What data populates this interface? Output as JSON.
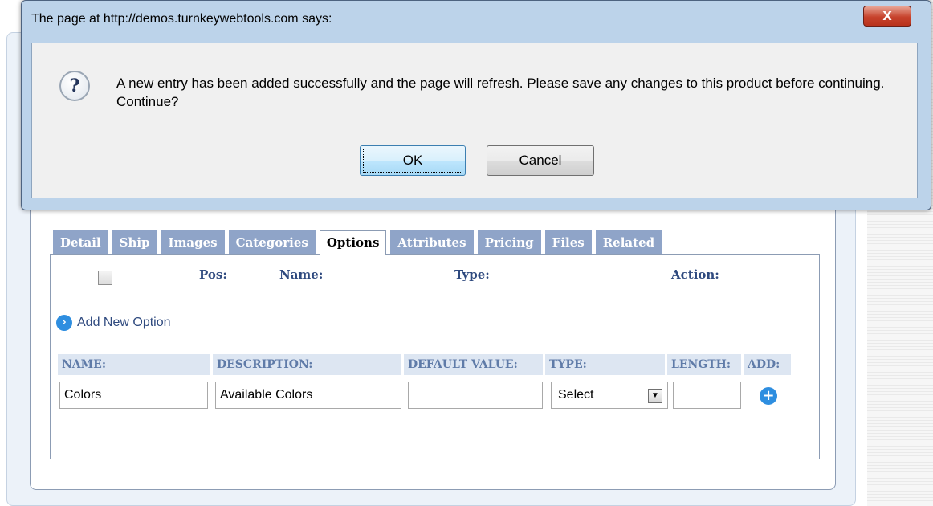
{
  "dialog": {
    "title": "The page at http://demos.turnkeywebtools.com says:",
    "close_label": "X",
    "icon": "question-icon",
    "message": "A new entry has been added successfully and the page will refresh. Please save any changes to this product before continuing. Continue?",
    "ok_label": "OK",
    "cancel_label": "Cancel"
  },
  "tabs": [
    {
      "label": "Detail",
      "active": false
    },
    {
      "label": "Ship",
      "active": false
    },
    {
      "label": "Images",
      "active": false
    },
    {
      "label": "Categories",
      "active": false
    },
    {
      "label": "Options",
      "active": true
    },
    {
      "label": "Attributes",
      "active": false
    },
    {
      "label": "Pricing",
      "active": false
    },
    {
      "label": "Files",
      "active": false
    },
    {
      "label": "Related",
      "active": false
    }
  ],
  "options_table": {
    "headers": {
      "pos": "Pos:",
      "name": "Name:",
      "type": "Type:",
      "action": "Action:"
    }
  },
  "add_new_option": {
    "label": "Add New Option",
    "icon": "arrow-right-circle-icon"
  },
  "new_option_form": {
    "headers": {
      "name": "NAME:",
      "description": "DESCRIPTION:",
      "default_value": "DEFAULT VALUE:",
      "type": "TYPE:",
      "length": "LENGTH:",
      "add": "ADD:"
    },
    "name_value": "Colors",
    "description_value": "Available Colors",
    "default_value": "",
    "type_value": "Select",
    "length_value": "",
    "add_icon": "plus-circle-icon"
  },
  "colors": {
    "tab_bg": "#8fa4c8",
    "header_text": "#2f4a7f",
    "accent_blue": "#2e8ee0",
    "close_red": "#c7432d"
  }
}
